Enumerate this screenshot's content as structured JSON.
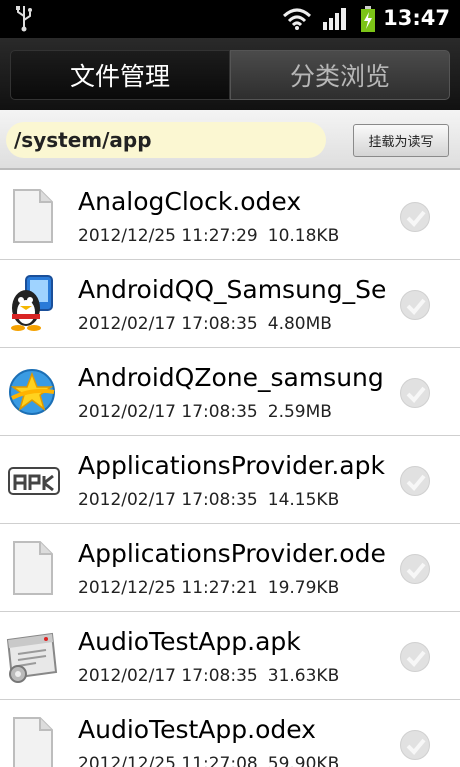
{
  "status": {
    "time": "13:47"
  },
  "tabs": [
    {
      "label": "文件管理"
    },
    {
      "label": "分类浏览"
    }
  ],
  "path": {
    "value": "/system/app",
    "mount_label": "挂载为读写"
  },
  "files": [
    {
      "name": "AnalogClock.odex",
      "date": "2012/12/25 11:27:29",
      "size": "10.18KB",
      "icon": "file-icon"
    },
    {
      "name": "AndroidQQ_Samsung_Se",
      "date": "2012/02/17 17:08:35",
      "size": "4.80MB",
      "icon": "qq-penguin-icon"
    },
    {
      "name": "AndroidQZone_samsung",
      "date": "2012/02/17 17:08:35",
      "size": "2.59MB",
      "icon": "qzone-star-icon"
    },
    {
      "name": "ApplicationsProvider.apk",
      "date": "2012/02/17 17:08:35",
      "size": "14.15KB",
      "icon": "apk-icon"
    },
    {
      "name": "ApplicationsProvider.ode",
      "date": "2012/12/25 11:27:21",
      "size": "19.79KB",
      "icon": "file-icon"
    },
    {
      "name": "AudioTestApp.apk",
      "date": "2012/02/17 17:08:35",
      "size": "31.63KB",
      "icon": "app-package-icon"
    },
    {
      "name": "AudioTestApp.odex",
      "date": "2012/12/25 11:27:08",
      "size": "59.90KB",
      "icon": "file-icon"
    }
  ]
}
